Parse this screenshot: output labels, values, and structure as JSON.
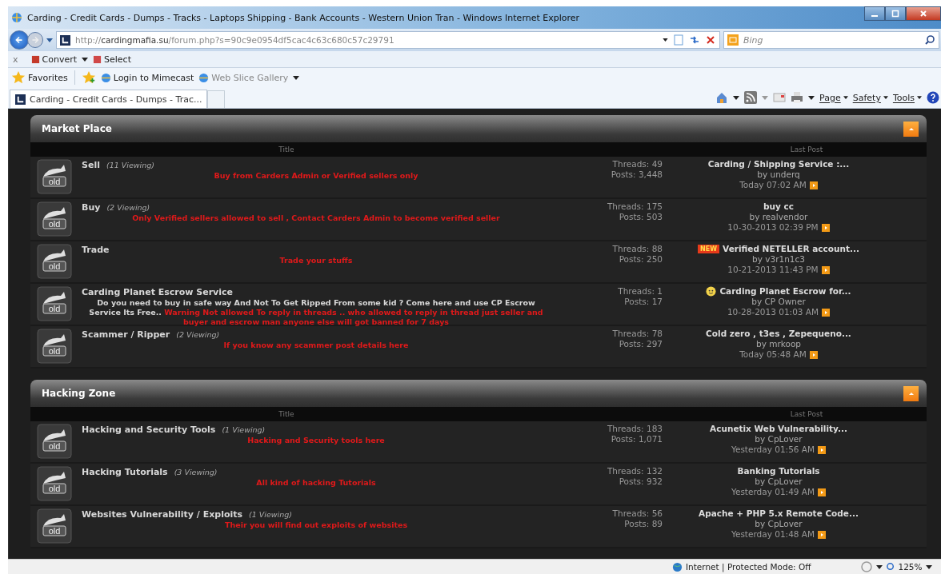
{
  "window": {
    "title": "Carding - Credit Cards - Dumps - Tracks - Laptops Shipping - Bank Accounts - Western Union Tran - Windows Internet Explorer"
  },
  "address_bar": {
    "url": "http://**cardingmafia.su**/forum.php?s=90c9e0954df5cac4c63c680c57c29791"
  },
  "search": {
    "placeholder": "Bing"
  },
  "command_bar": {
    "close": "x",
    "items": [
      "Convert",
      "Select"
    ]
  },
  "favorites_bar": {
    "favorites": "Favorites",
    "items": [
      {
        "label": "Login to Mimecast",
        "disabled": false
      },
      {
        "label": "Web Slice Gallery",
        "disabled": true
      }
    ]
  },
  "tabs": [
    {
      "label": "Carding - Credit Cards - Dumps - Trac...",
      "selected": true
    }
  ],
  "toolbar": {
    "items": [
      "Page",
      "Safety",
      "Tools"
    ]
  },
  "sections": [
    {
      "title": "Market Place",
      "col_title": "Title",
      "col_last": "Last Post",
      "forums": [
        {
          "name": "Sell",
          "viewing": "(11 Viewing)",
          "icon_label": "old",
          "description": [
            {
              "text": "Buy from Carders Admin or Verified sellers only",
              "color": "#e0191a"
            }
          ],
          "threads": "Threads: 49",
          "posts": "Posts: 3,448",
          "last_title": "Carding / Shipping Service :...",
          "last_by": "by underq",
          "last_date": "Today 07:02 AM"
        },
        {
          "name": "Buy",
          "viewing": "(2 Viewing)",
          "icon_label": "old",
          "description": [
            {
              "text": "Only Verified sellers allowed to sell , Contact Carders Admin to become verified seller",
              "color": "#e0191a"
            }
          ],
          "threads": "Threads: 175",
          "posts": "Posts: 503",
          "last_title": "buy cc",
          "last_by": "by realvendor",
          "last_date": "10-30-2013 02:39 PM"
        },
        {
          "name": "Trade",
          "icon_label": "old",
          "description": [
            {
              "text": "Trade your stuffs",
              "color": "#e0191a"
            }
          ],
          "threads": "Threads: 88",
          "posts": "Posts: 250",
          "last_prefix": {
            "kind": "badge",
            "text": "NEW"
          },
          "last_title": "Verified NETELLER account...",
          "last_by": "by v3r1n1c3",
          "last_date": "10-21-2013 11:43 PM"
        },
        {
          "name": "Carding Planet Escrow Service",
          "icon_label": "old",
          "description": [
            {
              "text": "Do you need to buy in safe way And Not To Get Ripped From some kid ? Come here and use CP Escrow Service Its Free..",
              "color": "#d8d8d8"
            },
            {
              "text": "Warning Not allowed To reply in threads .. who allowed to reply in thread just seller and buyer and escrow man anyone else will got banned for 7 days",
              "color": "#e0191a"
            }
          ],
          "threads": "Threads: 1",
          "posts": "Posts: 17",
          "last_prefix": {
            "kind": "smiley"
          },
          "last_title": "Carding Planet Escrow for...",
          "last_by": "by CP Owner",
          "last_date": "10-28-2013 01:03 AM"
        },
        {
          "name": "Scammer / Ripper",
          "viewing": "(2 Viewing)",
          "icon_label": "old",
          "description": [
            {
              "text": "If you know any scammer post details here",
              "color": "#e0191a"
            }
          ],
          "threads": "Threads: 78",
          "posts": "Posts: 297",
          "last_title": "Cold zero , t3es , Zepequeno...",
          "last_by": "by mrkoop",
          "last_date": "Today 05:48 AM"
        }
      ]
    },
    {
      "title": "Hacking Zone",
      "col_title": "Title",
      "col_last": "Last Post",
      "forums": [
        {
          "name": "Hacking and Security Tools",
          "viewing": "(1 Viewing)",
          "icon_label": "old",
          "description": [
            {
              "text": "Hacking and Security tools here",
              "color": "#e0191a"
            }
          ],
          "threads": "Threads: 183",
          "posts": "Posts: 1,071",
          "last_title": "Acunetix Web Vulnerability...",
          "last_by": "by CpLover",
          "last_date": "Yesterday 01:56 AM"
        },
        {
          "name": "Hacking Tutorials",
          "viewing": "(3 Viewing)",
          "icon_label": "old",
          "description": [
            {
              "text": "All kind of hacking Tutorials",
              "color": "#e0191a"
            }
          ],
          "threads": "Threads: 132",
          "posts": "Posts: 932",
          "last_title": "Banking Tutorials",
          "last_by": "by CpLover",
          "last_date": "Yesterday 01:49 AM"
        },
        {
          "name": "Websites Vulnerability / Exploits",
          "viewing": "(1 Viewing)",
          "icon_label": "old",
          "description": [
            {
              "text": "Their you will find out exploits of websites",
              "color": "#e0191a"
            }
          ],
          "threads": "Threads: 56",
          "posts": "Posts: 89",
          "last_title": "Apache + PHP 5.x Remote Code...",
          "last_by": "by CpLover",
          "last_date": "Yesterday 01:48 AM"
        }
      ]
    }
  ],
  "status_bar": {
    "zone": "Internet | Protected Mode: Off",
    "zoom": "125%"
  }
}
